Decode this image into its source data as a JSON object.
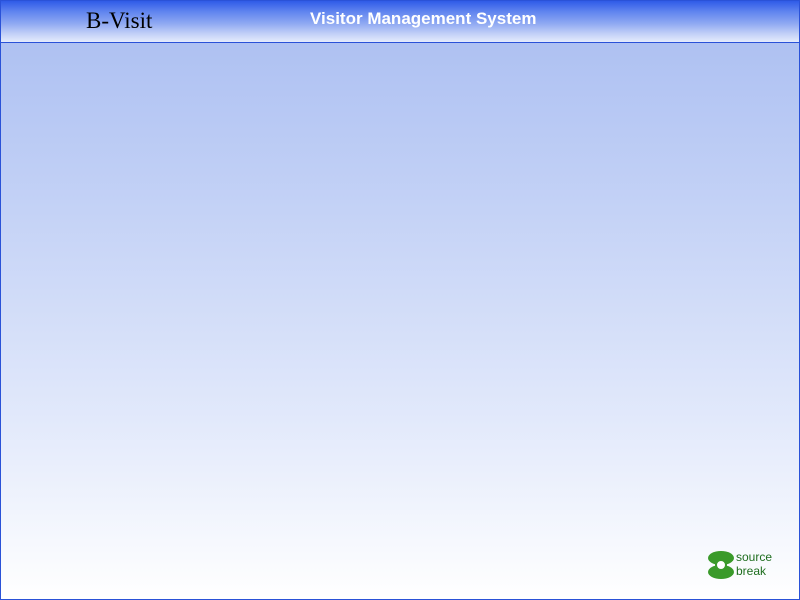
{
  "app": {
    "brand": "B-Visit",
    "title": "Visitor Management System"
  },
  "logo": {
    "word_top": "source",
    "word_bottom": "break",
    "icon": "sourcebreak-logo-icon",
    "color": "#3a9a2a"
  },
  "colors": {
    "border": "#2a52d8",
    "header_top": "#2f5be8",
    "background_top": "#a9bdf1",
    "background_bottom": "#ffffff"
  }
}
